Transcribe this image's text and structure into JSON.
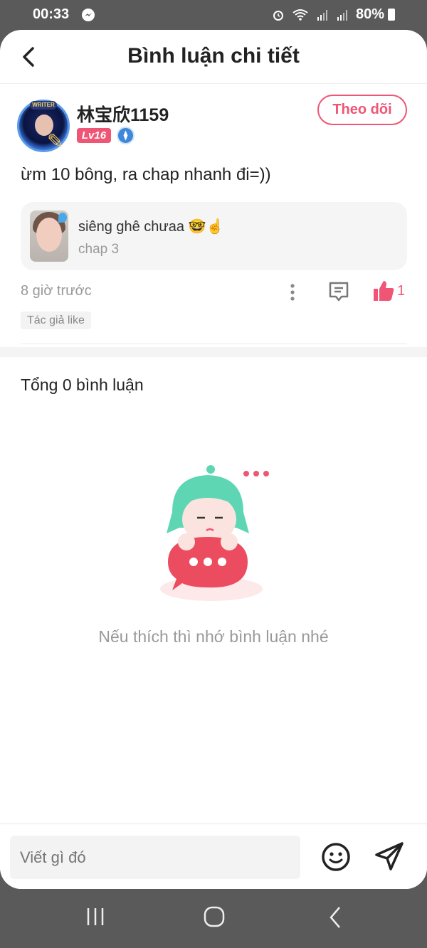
{
  "status_bar": {
    "time": "00:33",
    "battery": "80%"
  },
  "header": {
    "title": "Bình luận chi tiết"
  },
  "comment": {
    "username": "林宝欣1159",
    "level": "Lv16",
    "avatar_badge": "WRITER",
    "follow_label": "Theo dõi",
    "text": "ừm 10 bông, ra chap nhanh đi=))",
    "chapter_title": "siêng ghê chưaa 🤓☝️",
    "chapter_sub": "chap 3",
    "time": "8 giờ trước",
    "like_count": "1",
    "author_like": "Tác giả like"
  },
  "replies": {
    "total_label": "Tổng 0 bình luận",
    "empty_text": "Nếu thích thì nhớ bình luận nhé"
  },
  "input": {
    "placeholder": "Viết gì đó"
  },
  "colors": {
    "accent": "#ef5574",
    "muted": "#999999"
  }
}
